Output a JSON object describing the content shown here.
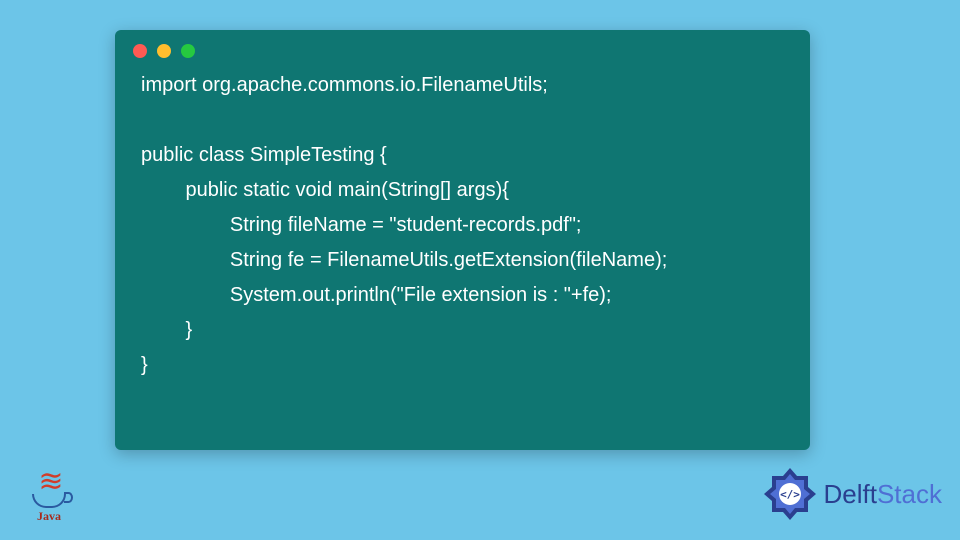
{
  "window": {
    "dots": [
      "red",
      "yellow",
      "green"
    ]
  },
  "code": {
    "lines": [
      "import org.apache.commons.io.FilenameUtils;",
      "",
      "public class SimpleTesting {",
      "\tpublic static void main(String[] args){",
      "\t\tString fileName = \"student-records.pdf\";",
      "\t\tString fe = FilenameUtils.getExtension(fileName);",
      "\t\tSystem.out.println(\"File extension is : \"+fe);",
      "\t}",
      "}"
    ]
  },
  "branding": {
    "java_label": "Java",
    "delftstack_prefix": "Delft",
    "delftstack_suffix": "Stack"
  }
}
